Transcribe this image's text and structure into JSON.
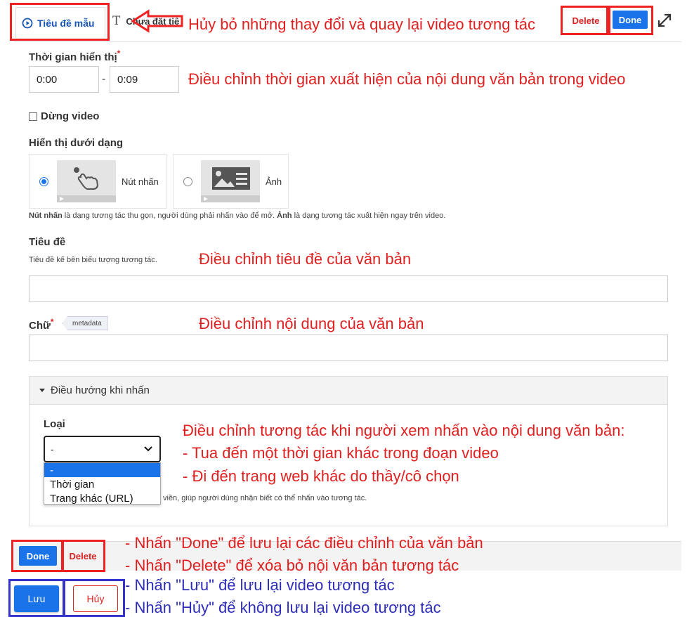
{
  "header": {
    "active_tab_label": "Tiêu đề mẫu",
    "untitled_tab_label": "Chưa đặt tiê",
    "delete_label": "Delete",
    "done_label": "Done"
  },
  "annotations": {
    "cancel_note": "Hủy bỏ  những thay đổi và quay lại video tương tác",
    "time_note": "Điều chỉnh thời gian xuất hiện của nội dung văn bản trong video",
    "title_note": "Điều chỉnh tiêu đề của văn bản",
    "text_note": "Điều chỉnh nội dung của văn bản",
    "nav_note_1": "Điều chỉnh tương tác khi người xem nhấn vào nội dung văn bản:",
    "nav_note_2": "- Tua đến một thời gian khác trong đoạn video",
    "nav_note_3": "- Đi đến trang web khác do thầy/cô chọn",
    "done_note": "- Nhấn \"Done\" để lưu lại các điều chỉnh của văn bản",
    "delete_note": "- Nhấn \"Delete\" để xóa bỏ nội văn bản tương tác",
    "save_note": "- Nhấn \"Lưu\" để lưu lại video tương tác",
    "cancel_save_note": "- Nhấn \"Hủy\" để không lưu lại video tương tác"
  },
  "form": {
    "display_time_label": "Thời gian hiển thị",
    "time_start": "0:00",
    "time_separator": "-",
    "time_end": "0:09",
    "pause_video_label": "Dừng video",
    "display_as_label": "Hiển thị dưới dạng",
    "option_button_label": "Nút nhấn",
    "option_image_label": "Ảnh",
    "display_hint_bold1": "Nút nhấn",
    "display_hint_text1": " là dạng tương tác thu gọn, người dùng phải nhấn vào để mở. ",
    "display_hint_bold2": "Ảnh",
    "display_hint_text2": " là dạng tương tác xuất hiện ngay trên video.",
    "title_label": "Tiêu đề",
    "title_hint": "Tiêu đề kế bên biểu tượng tương tác.",
    "text_label": "Chữ",
    "metadata_tag": "metadata",
    "goto_panel_label": "Điều hướng khi nhấn",
    "type_label": "Loại",
    "type_selected": "-",
    "type_options": [
      "-",
      "Thời gian",
      "Trang khác (URL)"
    ],
    "goto_hint": "viền, giúp người dùng nhận biết có thể nhấn vào tương tác."
  },
  "footer": {
    "done_label": "Done",
    "delete_label": "Delete",
    "save_label": "Lưu",
    "cancel_label": "Hủy"
  },
  "colors": {
    "accent_blue": "#1a73e8",
    "annotation_red": "#e02020",
    "annotation_blue": "#2d2db8"
  }
}
